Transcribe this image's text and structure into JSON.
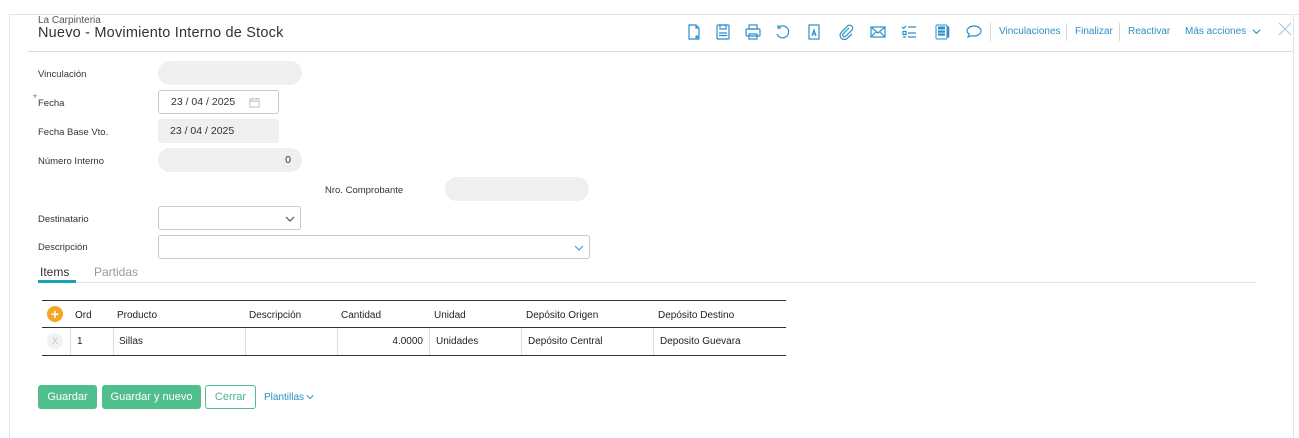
{
  "header": {
    "company": "La Carpinteria",
    "title": "Nuevo - Movimiento Interno de Stock"
  },
  "toolbar": {
    "icons": [
      "new-document-icon",
      "save-icon",
      "print-icon",
      "undo-icon",
      "text-format-icon",
      "attachment-icon",
      "email-icon",
      "checklist-icon",
      "notes-icon",
      "comment-icon"
    ],
    "links": {
      "vinculaciones": "Vinculaciones",
      "finalizar": "Finalizar",
      "reactivar": "Reactivar",
      "mas_acciones": "Más acciones"
    }
  },
  "form": {
    "vinculacion": {
      "label": "Vinculación",
      "value": ""
    },
    "fecha": {
      "label": "Fecha",
      "required_mark": "*",
      "value": "23 / 04 / 2025"
    },
    "fecha_base_vto": {
      "label": "Fecha Base Vto.",
      "value": "23 / 04 / 2025"
    },
    "numero_interno": {
      "label": "Número Interno",
      "value": "0"
    },
    "nro_comprobante": {
      "label": "Nro. Comprobante",
      "value": ""
    },
    "destinatario": {
      "label": "Destinatario",
      "value": ""
    },
    "descripcion": {
      "label": "Descripción",
      "value": ""
    }
  },
  "tabs": [
    {
      "label": "Items",
      "active": true
    },
    {
      "label": "Partidas",
      "active": false
    }
  ],
  "table": {
    "add_symbol": "+",
    "delete_symbol": "X",
    "headers": {
      "ord": "Ord",
      "producto": "Producto",
      "descripcion": "Descripción",
      "cantidad": "Cantidad",
      "unidad": "Unidad",
      "deposito_origen": "Depósito Origen",
      "deposito_destino": "Depósito Destino"
    },
    "rows": [
      {
        "ord": "1",
        "producto": "Sillas",
        "descripcion": "",
        "cantidad": "4.0000",
        "unidad": "Unidades",
        "deposito_origen": "Depósito Central",
        "deposito_destino": "Deposito Guevara"
      }
    ]
  },
  "footer": {
    "guardar": "Guardar",
    "guardar_nuevo": "Guardar y nuevo",
    "cerrar": "Cerrar",
    "plantillas": "Plantillas"
  },
  "colors": {
    "accent_green": "#4fc08d",
    "link_blue": "#2b8fc9",
    "tab_underline": "#1aa3b5",
    "add_orange": "#f5a623"
  }
}
